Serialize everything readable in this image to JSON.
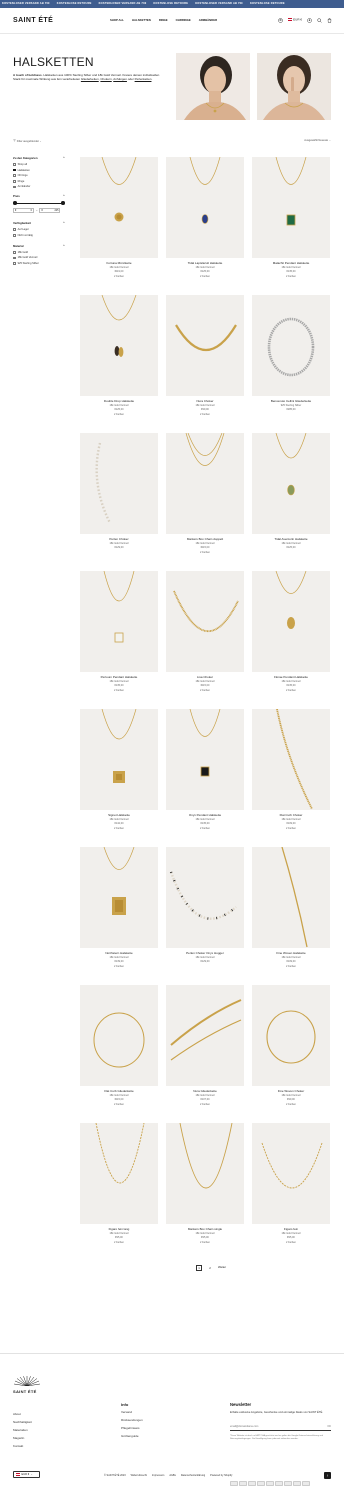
{
  "announcement": {
    "items": [
      "KOSTENLOSER VERSAND AB 70€",
      "KOSTENLOSE RETOURE",
      "KOSTENLOSER VERSAND AB 70€",
      "KOSTENLOSE RETOURE",
      "KOSTENLOSER VERSAND AB 70€",
      "KOSTENLOSE RETOURE"
    ]
  },
  "header": {
    "logo": "SAINT ÉTÉ",
    "nav": [
      "SHOP ALL",
      "HALSKETTEN",
      "RINGE",
      "OHRRINGE",
      "ARMBÄNDER"
    ],
    "currency": "EUR €"
  },
  "hero": {
    "title": "HALSKETTEN",
    "desc_bold": "A touch of boldness",
    "desc_rest": ". Halsketten aus 100% Sterling Silber und 18k Gold Vermeil. Kreiere deinen individuellen Stack für maximale Wirkung aus fein verarbeiteten",
    "link1": "Gliederketten",
    "sep1": ", ",
    "link2": "Chokern",
    "sep2": ", ",
    "link3": "Anhängen",
    "sep3": " oder ",
    "link4": "Perlenketten",
    "end": "."
  },
  "toolbar": {
    "filter_toggle": "Filter ausgeblendet",
    "sort": "Ausgewählt  Neueste"
  },
  "filters": {
    "categories_title": "Zu den Kategorien",
    "categories": [
      {
        "label": "Shop all",
        "checked": false
      },
      {
        "label": "Halsketten",
        "checked": true
      },
      {
        "label": "Ohrringe",
        "checked": false
      },
      {
        "label": "Ringe",
        "checked": false
      },
      {
        "label": "Armbänder",
        "checked": false
      }
    ],
    "price_title": "Preis",
    "price_min": "0",
    "price_max": "225",
    "currency_symbol": "€",
    "availability_title": "Verfügbarkeit",
    "availability": [
      {
        "label": "Auf Lager",
        "checked": false
      },
      {
        "label": "Nicht vorrätig",
        "checked": false
      }
    ],
    "material_title": "Material",
    "material": [
      {
        "label": "18k Gold",
        "checked": false
      },
      {
        "label": "18k Gold Vermeil",
        "checked": false
      },
      {
        "label": "925 Sterling Silber",
        "checked": false
      }
    ]
  },
  "products": [
    {
      "name": "Fortuna Münzkette",
      "material": "18k Gold Vermeil",
      "price": "€119,00",
      "colors": "2 Farben",
      "art": "coin"
    },
    {
      "name": "Tidal Lapislazuli Halskette",
      "material": "18k Gold Vermeil",
      "price": "€125,00",
      "colors": "2 Farben",
      "art": "blue"
    },
    {
      "name": "Malachit Pendant Halskette",
      "material": "18k Gold Vermeil",
      "price": "€135,00",
      "colors": "2 Farben",
      "art": "green"
    },
    {
      "name": "Double Drop Halskette",
      "material": "18k Gold Vermeil",
      "price": "€125,00",
      "colors": "2 Farben",
      "art": "drop"
    },
    {
      "name": "Nura Choker",
      "material": "18k Gold Vermeil",
      "price": "€99,00",
      "colors": "2 Farben",
      "art": "snake"
    },
    {
      "name": "Benvenuto Cellini Gliederkette",
      "material": "925 Sterling Silber",
      "price": "€285,00",
      "colors": "",
      "art": "silver"
    },
    {
      "name": "Perlen Choker",
      "material": "18k Gold Vermeil",
      "price": "€129,00",
      "colors": "",
      "art": "pearls"
    },
    {
      "name": "Markers Box Chain doppelt",
      "material": "18k Gold Vermeil",
      "price": "€115,00",
      "colors": "2 Farben",
      "art": "double"
    },
    {
      "name": "Tidal Aventurin Halskette",
      "material": "18k Gold Vermeil",
      "price": "€125,00",
      "colors": "",
      "art": "aventurin"
    },
    {
      "name": "Pertuum Pendant Halskette",
      "material": "18k Gold Vermeil",
      "price": "€135,00",
      "colors": "2 Farben",
      "art": "glass"
    },
    {
      "name": "Lisa Choker",
      "material": "18k Gold Vermeil",
      "price": "€115,00",
      "colors": "2 Farben",
      "art": "rope"
    },
    {
      "name": "Florae Pendant Halskette",
      "material": "18k Gold Vermeil",
      "price": "€135,00",
      "colors": "2 Farben",
      "art": "oval"
    },
    {
      "name": "Signet Halskette",
      "material": "18k Gold Vermeil",
      "price": "€142,00",
      "colors": "2 Farben",
      "art": "signet"
    },
    {
      "name": "Onyx Pendant Halskette",
      "material": "18k Gold Vermeil",
      "price": "€135,00",
      "colors": "2 Farben",
      "art": "onyx"
    },
    {
      "name": "Flat Curb Choker",
      "material": "18k Gold Vermeil",
      "price": "€109,00",
      "colors": "2 Farben",
      "art": "flat"
    },
    {
      "name": "Northstern Halskette",
      "material": "18k Gold Vermeil",
      "price": "€139,00",
      "colors": "2 Farben",
      "art": "tag"
    },
    {
      "name": "Perlen Choker Onyx Hugger",
      "material": "18k Gold Vermeil",
      "price": "€129,00",
      "colors": "",
      "art": "onyxpearls"
    },
    {
      "name": "Fine Woven Halskette",
      "material": "18k Gold Vermeil",
      "price": "€109,00",
      "colors": "2 Farben",
      "art": "woven"
    },
    {
      "name": "Flat Curb Gliederkette",
      "material": "18k Gold Vermeil",
      "price": "€115,00",
      "colors": "2 Farben",
      "art": "ring"
    },
    {
      "name": "Nura Gliederkette",
      "material": "18k Gold Vermeil",
      "price": "€107,00",
      "colors": "2 Farben",
      "art": "snake2"
    },
    {
      "name": "Fine Woven Choker",
      "material": "18k Gold Vermeil",
      "price": "€99,00",
      "colors": "2 Farben",
      "art": "ring2"
    },
    {
      "name": "Figaro fein lang",
      "material": "18k Gold Vermeil",
      "price": "€95,00",
      "colors": "2 Farben",
      "art": "chain"
    },
    {
      "name": "Markers Box Chain single",
      "material": "18k Gold Vermeil",
      "price": "€95,00",
      "colors": "2 Farben",
      "art": "chain2"
    },
    {
      "name": "Figaro fein",
      "material": "18k Gold Vermeil",
      "price": "€95,00",
      "colors": "2 Farben",
      "art": "chain3"
    }
  ],
  "pagination": {
    "pages": [
      "1",
      "2"
    ],
    "next": "Weiter"
  },
  "footer": {
    "logo": "SAINT ÉTÉ",
    "col1": [
      "About",
      "Nachhaltigkeit",
      "Materialien",
      "Magazin",
      "Kontakt"
    ],
    "info_title": "Info",
    "col2": [
      "Versand",
      "Rücksendungen",
      "Pflegehinweis",
      "Größenguide"
    ],
    "newsletter_title": "Newsletter",
    "newsletter_text": "Erhalte exklusive Angebote, Geschenke und einmalige Deals von SAINT ÉTÉ.",
    "newsletter_placeholder": "email@domaindame.com",
    "newsletter_button": "OK",
    "newsletter_note": "*Diese Website ist durch reCAPTCHA geschützt und es gelten die Google-Datenschutzerklärung und Nutzungsbedingungen. Die Einwilligung kann jederzeit widerrufen werden.",
    "currency": "EUR €",
    "legal": [
      "© SAINT ÉTÉ 2023",
      "Widerrufsrecht",
      "Impressum",
      "AGBs",
      "Datenschutzerklärung",
      "Powered by Shopify"
    ],
    "payments": [
      "amex",
      "apple-pay",
      "google-pay",
      "klarna",
      "maestro",
      "mastercard",
      "paypal",
      "shop-pay",
      "visa"
    ]
  },
  "colors": {
    "announcement_bg": "#3f5d8f",
    "gold": "#c9a24a",
    "image_bg": "#f1efec"
  }
}
